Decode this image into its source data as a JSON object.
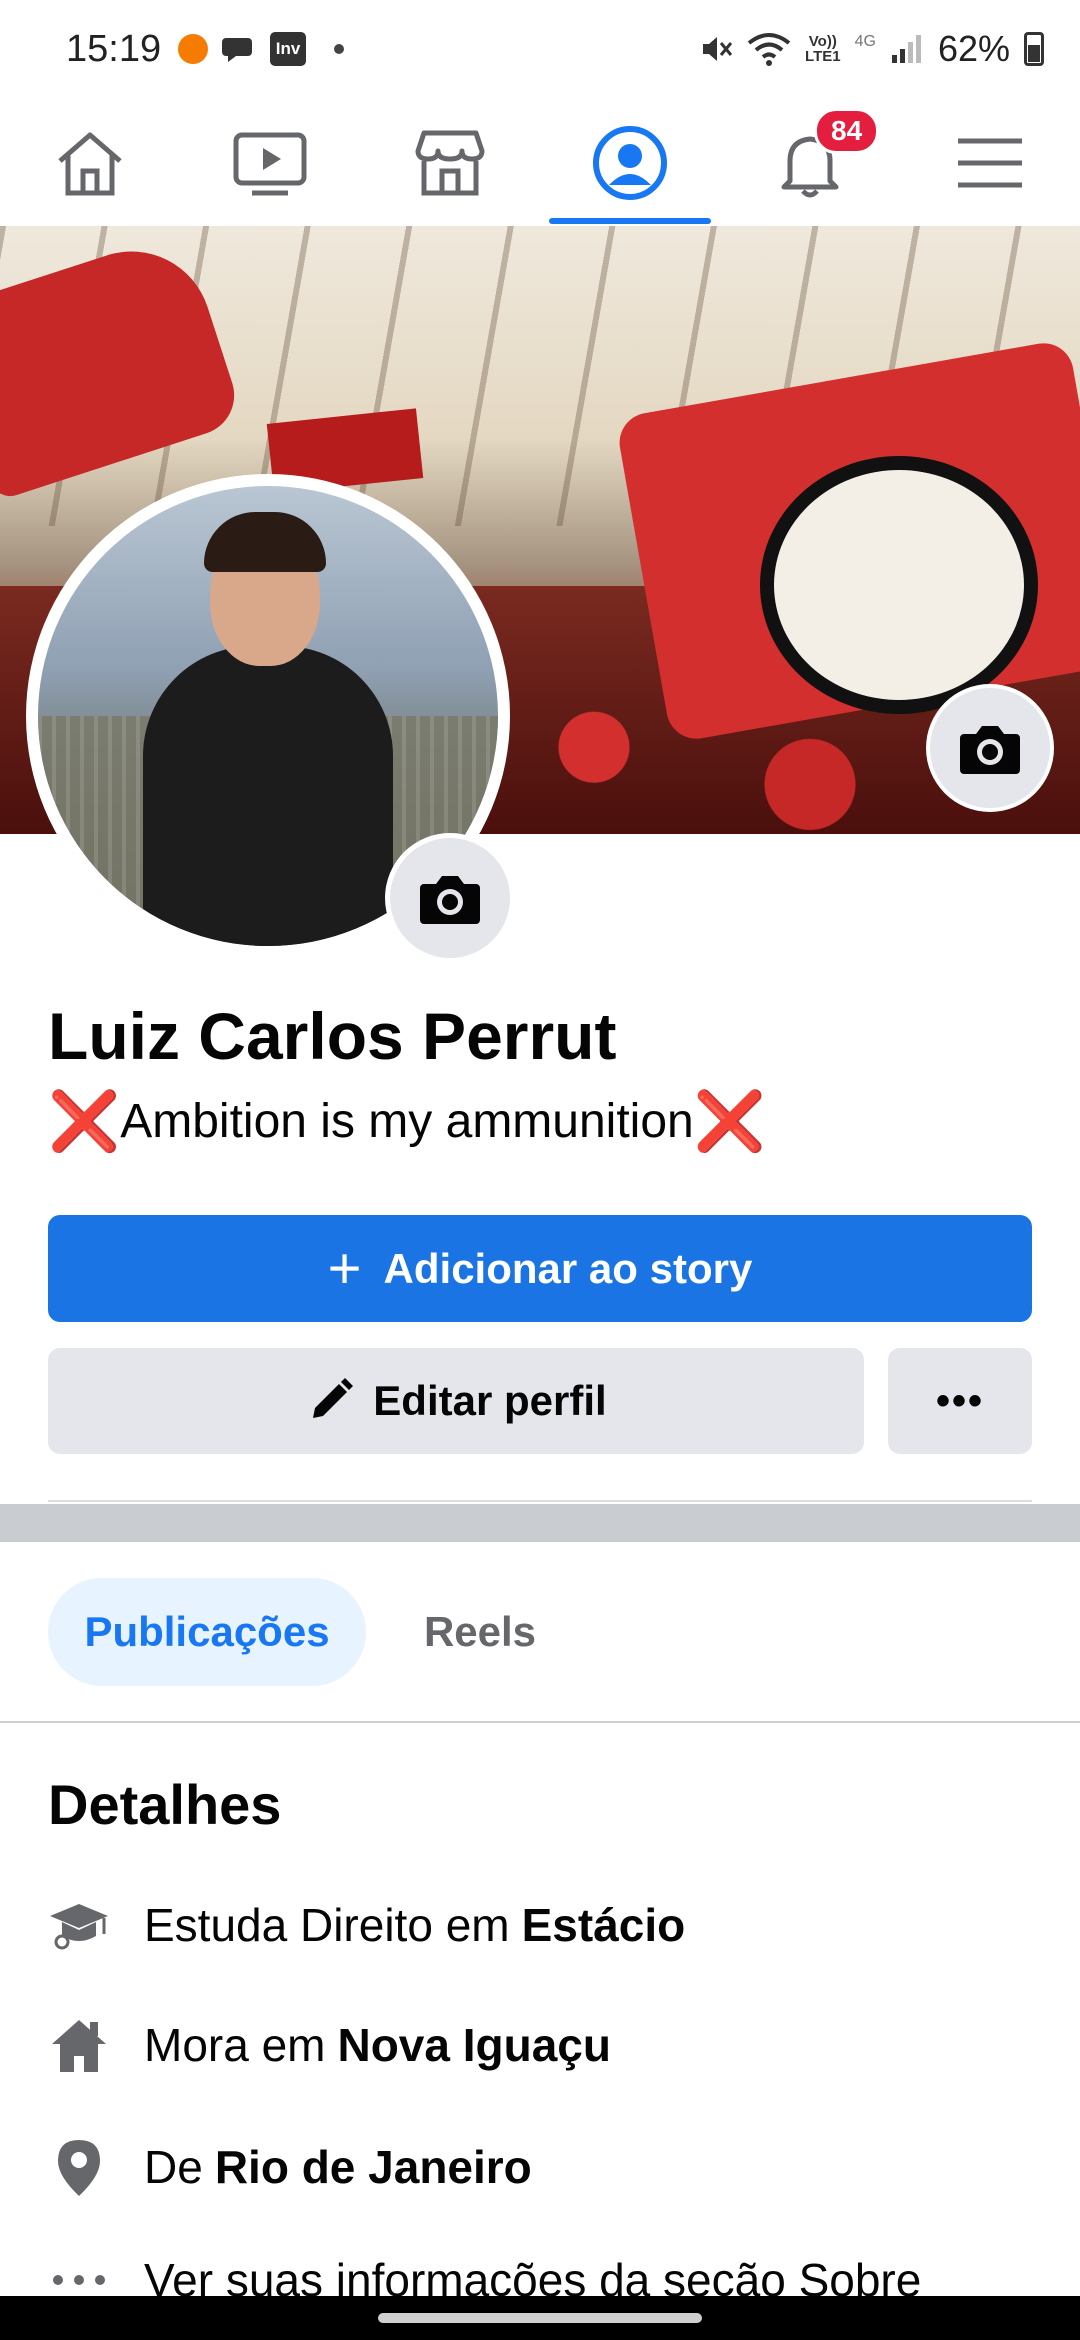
{
  "status_bar": {
    "time": "15:19",
    "app_icon_label": "Inv",
    "network_top": "Vo))",
    "network_bottom": "LTE1",
    "network_type": "4G",
    "battery": "62%"
  },
  "nav": {
    "items": [
      {
        "name": "home",
        "icon": "home-icon"
      },
      {
        "name": "watch",
        "icon": "video-icon"
      },
      {
        "name": "marketplace",
        "icon": "store-icon"
      },
      {
        "name": "profile",
        "icon": "profile-icon",
        "active": true
      },
      {
        "name": "notifications",
        "icon": "bell-icon"
      },
      {
        "name": "menu",
        "icon": "hamburger-icon"
      }
    ],
    "notification_count": "84",
    "active_color": "#1877f2"
  },
  "profile": {
    "name": "Luiz Carlos Perrut",
    "bio_text": "Ambition is my ammunition",
    "bio_emoji": "❌"
  },
  "actions": {
    "add_story_plus": "+",
    "add_story_label": "Adicionar ao story",
    "edit_profile_label": "Editar perfil",
    "more_label": "•••"
  },
  "tabs": [
    {
      "label": "Publicações",
      "active": true
    },
    {
      "label": "Reels",
      "active": false
    }
  ],
  "details": {
    "title": "Detalhes",
    "education_prefix": "Estuda Direito em",
    "education_place": "Estácio",
    "lives_prefix": "Mora em",
    "lives_place": "Nova Iguaçu",
    "from_prefix": "De",
    "from_place": "Rio de Janeiro",
    "about_link": "Ver suas informações da seção Sobre"
  },
  "colors": {
    "primary": "#1b74e4",
    "secondary_button": "#e4e6eb",
    "active_tab_bg": "#e7f3ff",
    "badge": "#e41e3f"
  }
}
